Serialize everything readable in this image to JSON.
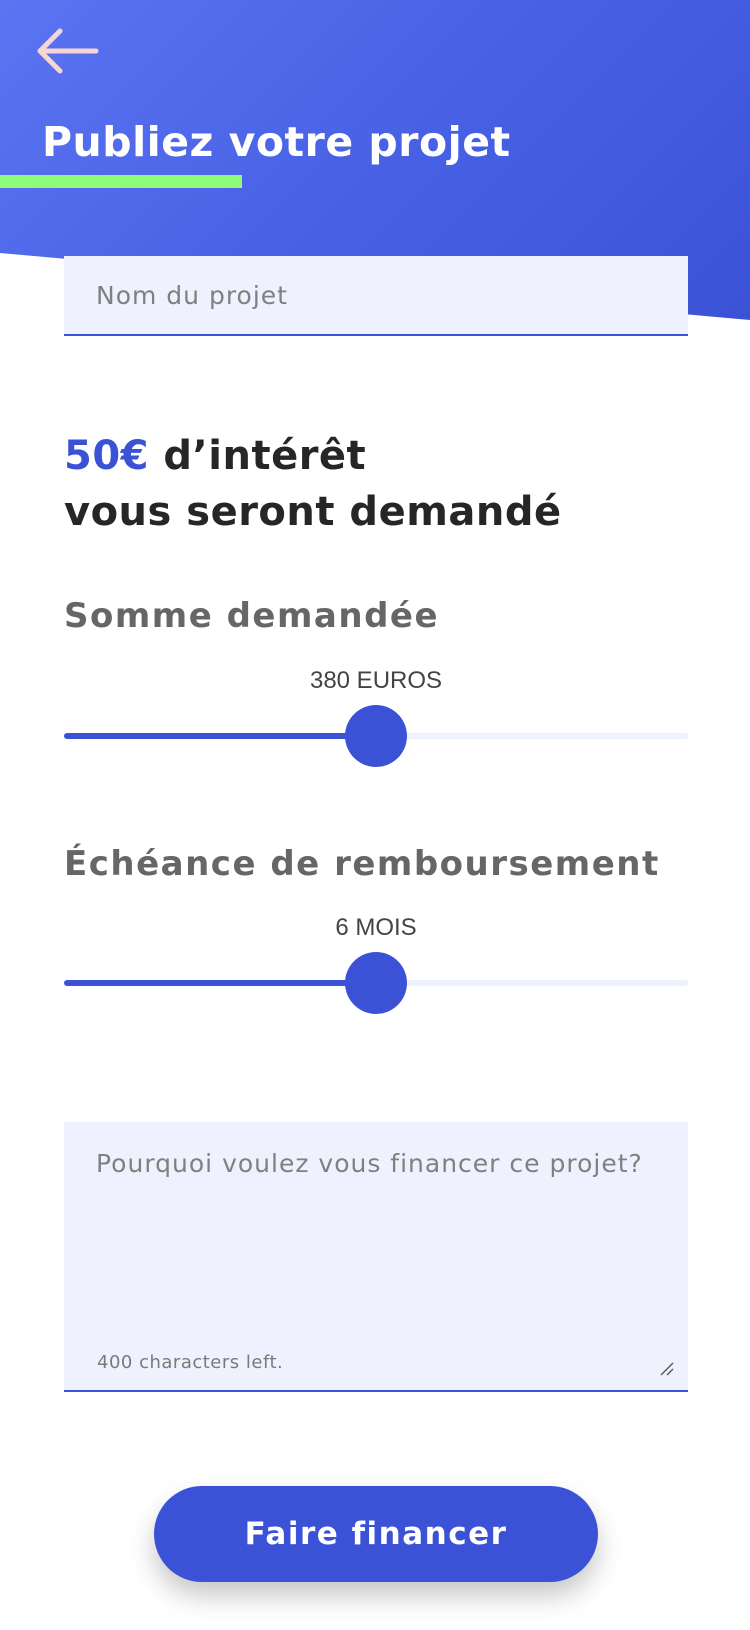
{
  "header": {
    "title": "Publiez votre projet",
    "back_icon": "arrow-left-icon"
  },
  "project_name": {
    "value": "",
    "placeholder": "Nom du projet"
  },
  "interest": {
    "amount": "50€",
    "line1_rest": " d’intérêt",
    "line2": "vous seront demandé"
  },
  "amount_slider": {
    "label": "Somme demandée",
    "value_text": "380 EUROS",
    "position": 0.5
  },
  "term_slider": {
    "label": "Échéance de remboursement",
    "value_text": "6 MOIS",
    "position": 0.5
  },
  "reason": {
    "value": "",
    "placeholder": "Pourquoi voulez vous financer ce projet?",
    "chars_left": "400 characters left."
  },
  "submit": {
    "label": "Faire financer"
  },
  "colors": {
    "accent": "#3b52d6",
    "header_start": "#5b74f2",
    "header_end": "#3b52d6",
    "highlight": "#8efc7a",
    "field_bg": "#eff2fe",
    "back_arrow": "#f6d6d3"
  }
}
